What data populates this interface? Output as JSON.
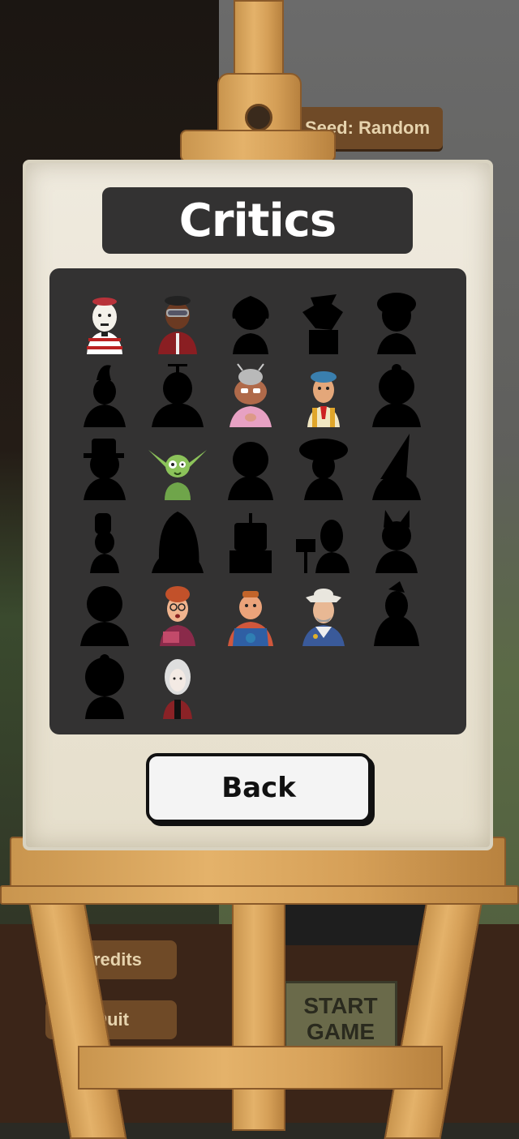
{
  "title": "Critics",
  "back_label": "Back",
  "background": {
    "seed_label": "Seed: Random",
    "side_buttons": [
      "Credits",
      "Quit"
    ],
    "start_label_line1": "START",
    "start_label_line2": "GAME"
  },
  "critics": [
    {
      "id": "mime",
      "unlocked": true
    },
    {
      "id": "goggles-tracksuit",
      "unlocked": true
    },
    {
      "id": "bob-hair",
      "unlocked": false
    },
    {
      "id": "scarecrow",
      "unlocked": false
    },
    {
      "id": "cowboy-hat",
      "unlocked": false
    },
    {
      "id": "witch-hook",
      "unlocked": false
    },
    {
      "id": "propeller-cap",
      "unlocked": false
    },
    {
      "id": "granny-antennae",
      "unlocked": true
    },
    {
      "id": "painter-beret",
      "unlocked": true
    },
    {
      "id": "curly-hair",
      "unlocked": false
    },
    {
      "id": "top-hat-gent",
      "unlocked": false
    },
    {
      "id": "goblin",
      "unlocked": true
    },
    {
      "id": "bald-head",
      "unlocked": false
    },
    {
      "id": "mushroom-cap",
      "unlocked": false
    },
    {
      "id": "wizard-hat",
      "unlocked": false
    },
    {
      "id": "chef",
      "unlocked": false
    },
    {
      "id": "long-hair",
      "unlocked": false
    },
    {
      "id": "robot",
      "unlocked": false
    },
    {
      "id": "sign-holder",
      "unlocked": false
    },
    {
      "id": "cat-ears",
      "unlocked": false
    },
    {
      "id": "round-head",
      "unlocked": false
    },
    {
      "id": "librarian",
      "unlocked": true
    },
    {
      "id": "farmer-overalls",
      "unlocked": true
    },
    {
      "id": "cowboy-sheriff",
      "unlocked": true
    },
    {
      "id": "vampire",
      "unlocked": false
    },
    {
      "id": "afro",
      "unlocked": false
    },
    {
      "id": "pale-lady",
      "unlocked": true
    }
  ],
  "colors": {
    "panel": "#333232",
    "card": "#efeade",
    "silhouette": "#000000",
    "wood": "#d59f57"
  }
}
